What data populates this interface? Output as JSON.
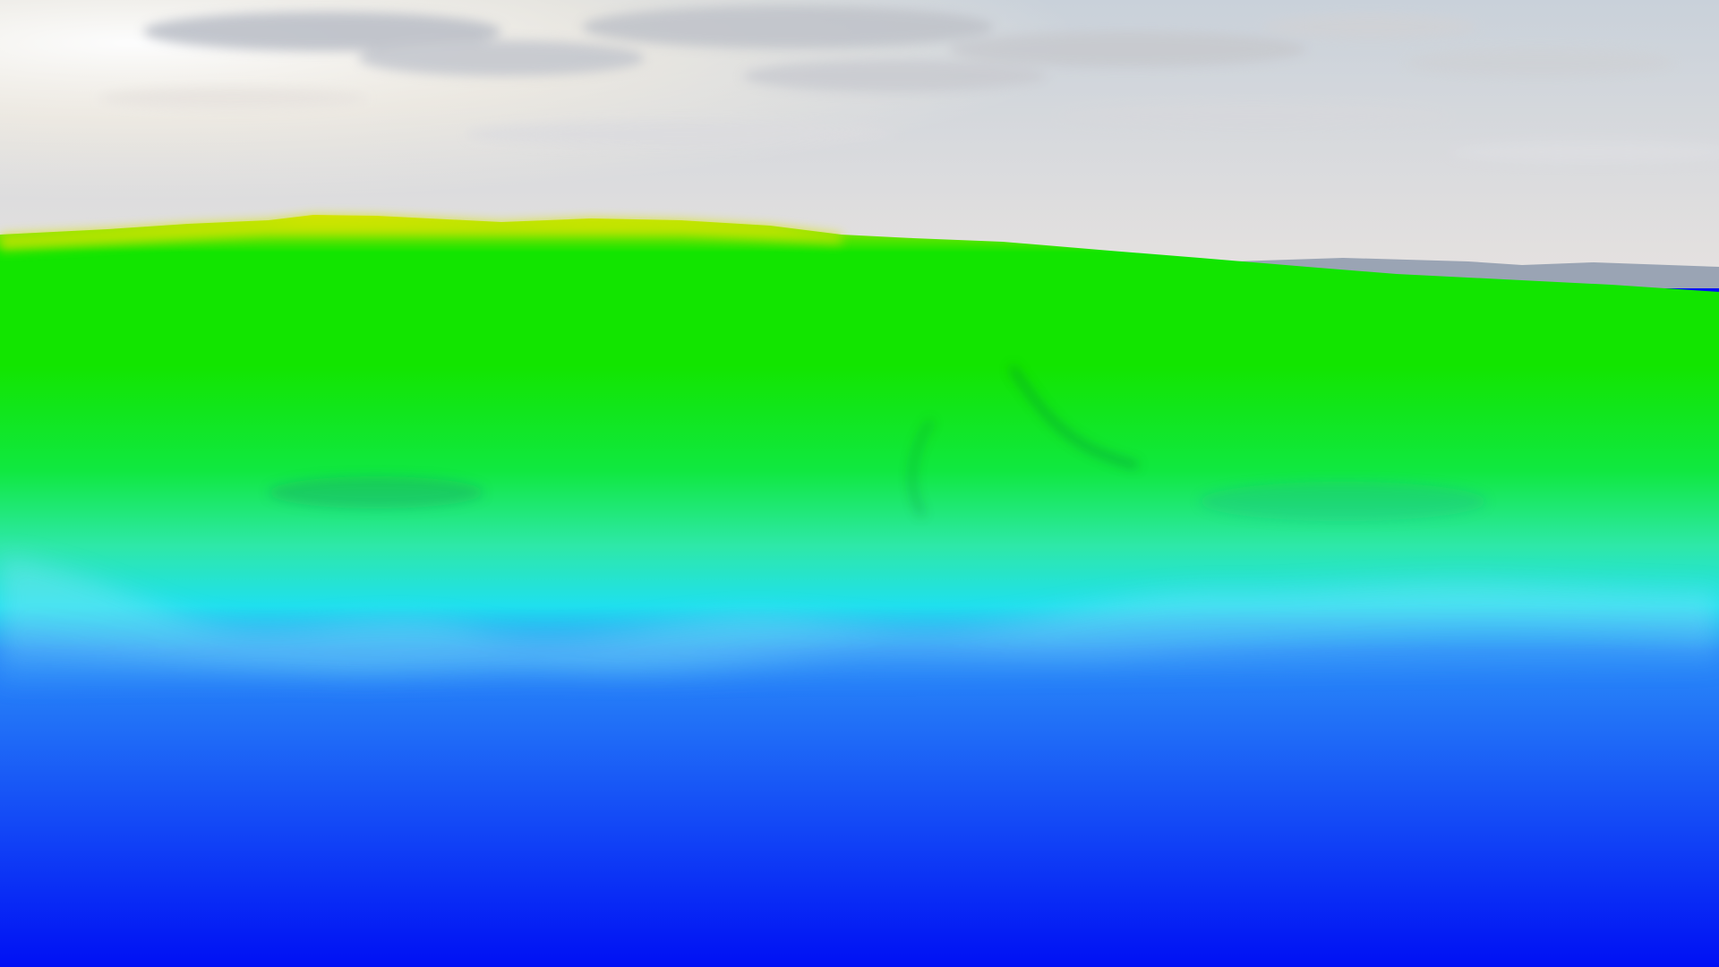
{
  "scene": {
    "kind": "3d-terrain-elevation-render",
    "colors": {
      "sky_top": "#c9d1da",
      "sky_glow": "#fff6e6",
      "sky_horizon": "#e6e2e0",
      "haze_mountains": "#9aa4b4",
      "ridge_yellow": "#d6e400",
      "high_green": "#12e500",
      "mid_green": "#10e840",
      "teal": "#2ee8a8",
      "cyan": "#1fe0ee",
      "light_blue": "#2a8cf8",
      "deep_blue": "#0010f4"
    },
    "colormap_order": [
      "yellow",
      "green",
      "teal",
      "cyan",
      "blue"
    ]
  }
}
